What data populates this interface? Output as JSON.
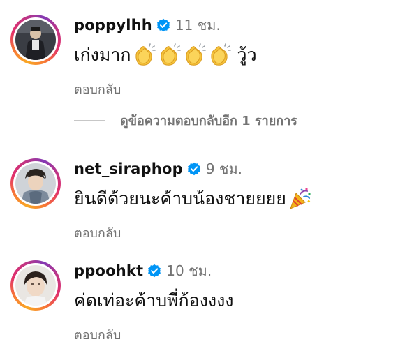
{
  "comments": [
    {
      "username": "poppylhh",
      "time": "11 ชม.",
      "text": "เก่งมาก",
      "emoji": "clapping-hands",
      "emoji_count": 4,
      "text_after": "วู้ว",
      "reply_label": "ตอบกลับ",
      "view_more_label": "ดูข้อความตอบกลับอีก 1 รายการ"
    },
    {
      "username": "net_siraphop",
      "time": "9 ชม.",
      "text": "ยินดีด้วยนะค้าบน้องชายยยย",
      "emoji": "party-popper",
      "reply_label": "ตอบกลับ"
    },
    {
      "username": "ppoohkt",
      "time": "10 ชม.",
      "text": "ค่ดเท่อะค้าบพี่ก้องงงง",
      "reply_label": "ตอบกลับ"
    }
  ],
  "colors": {
    "verified": "#0095f6",
    "secondary_text": "#737373",
    "primary_text": "#111111"
  }
}
